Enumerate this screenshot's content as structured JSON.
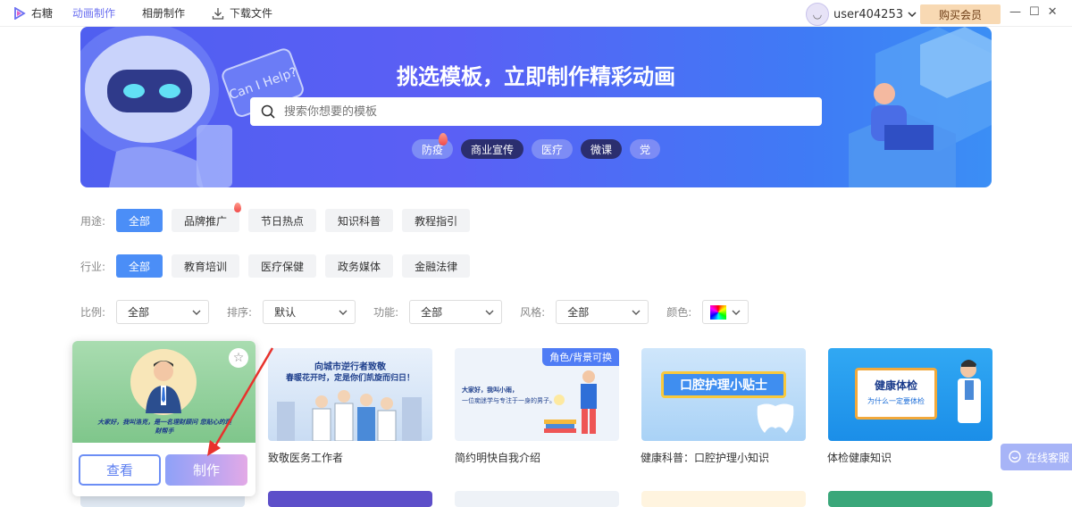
{
  "app": {
    "name": "右糖"
  },
  "nav": {
    "items": [
      "动画制作",
      "相册制作",
      "下载文件"
    ]
  },
  "user": {
    "name": "user404253",
    "vip_label": "购买会员"
  },
  "banner": {
    "title": "挑选模板，立即制作精彩动画",
    "search_placeholder": "搜索你想要的模板",
    "help_text": "Can I Help?",
    "hot_tags": [
      "防疫",
      "商业宣传",
      "医疗",
      "微课",
      "党"
    ]
  },
  "filters": {
    "usage": {
      "label": "用途:",
      "options": [
        "全部",
        "品牌推广",
        "节日热点",
        "知识科普",
        "教程指引"
      ]
    },
    "industry": {
      "label": "行业:",
      "options": [
        "全部",
        "教育培训",
        "医疗保健",
        "政务媒体",
        "金融法律"
      ]
    },
    "selects": [
      {
        "label": "比例:",
        "value": "全部"
      },
      {
        "label": "排序:",
        "value": "默认"
      },
      {
        "label": "功能:",
        "value": "全部"
      },
      {
        "label": "风格:",
        "value": "全部"
      }
    ],
    "color_label": "颜色:"
  },
  "hover_card": {
    "view_label": "查看",
    "make_label": "制作",
    "thumb_text": "大家好，我叫洛克，是一名理财顾问 您贴心的理财帮手"
  },
  "templates": [
    {
      "title": "致敬医务工作者",
      "thumb_lines": [
        "向城市逆行者致敬",
        "春暖花开时，定是你们凯旋而归日！"
      ]
    },
    {
      "title": "简约明快自我介绍",
      "badge": "角色/背景可换",
      "thumb_lines": [
        "大家好，我叫小雨，",
        "一位痴迷学与专注于一身的男子。"
      ]
    },
    {
      "title": "健康科普：口腔护理小知识",
      "thumb_lines": [
        "口腔护理小贴士"
      ]
    },
    {
      "title": "体检健康知识",
      "thumb_lines": [
        "健康体检",
        "为什么一定要体检"
      ]
    }
  ],
  "service": {
    "label": "在线客服"
  },
  "colors": {
    "accent": "#4b8ef7",
    "nav_active": "#6b70f0",
    "banner": "#5562f2"
  }
}
